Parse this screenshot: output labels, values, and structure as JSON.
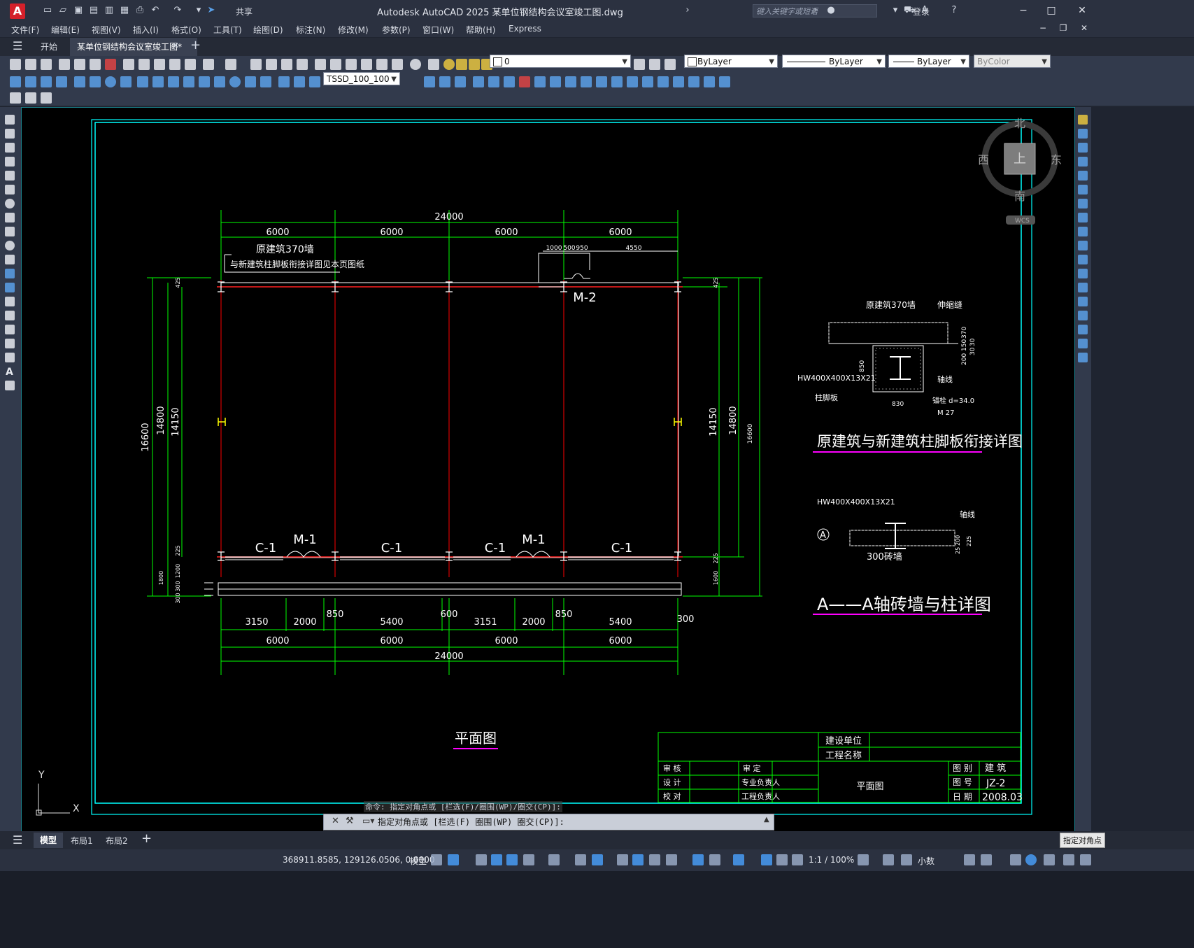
{
  "window": {
    "app_logo": "A",
    "title": "Autodesk AutoCAD 2025    某单位钢结构会议室竣工图.dwg",
    "share_label": "共享",
    "search_placeholder": "键入关键字或短语",
    "login_label": "登录"
  },
  "menu": [
    "文件(F)",
    "编辑(E)",
    "视图(V)",
    "插入(I)",
    "格式(O)",
    "工具(T)",
    "绘图(D)",
    "标注(N)",
    "修改(M)",
    "参数(P)",
    "窗口(W)",
    "帮助(H)",
    "Express"
  ],
  "tabs": {
    "start": "开始",
    "document": "某单位钢结构会议室竣工图*"
  },
  "toolbar": {
    "layer_value": "0",
    "color_value": "ByLayer",
    "linetype_value": "ByLayer",
    "lineweight_value": "ByLayer",
    "plotstyle_value": "ByColor",
    "dimstyle_value": "TSSD_100_100"
  },
  "viewcube": {
    "north": "北",
    "south": "南",
    "west": "西",
    "east": "东",
    "top": "上",
    "wcs": "WCS"
  },
  "drawing": {
    "plan_title": "平面图",
    "top_dims": [
      "24000",
      "6000",
      "6000",
      "6000",
      "6000"
    ],
    "top_detail_dims": [
      "1000",
      "500",
      "950",
      "4550"
    ],
    "note_line1": "原建筑370墙",
    "note_line2": "与新建筑柱脚板衔接详图见本页图纸",
    "door_top": "M-2",
    "openings": [
      "C-1",
      "M-1",
      "C-1",
      "C-1",
      "M-1",
      "C-1"
    ],
    "bottom_dims_row1": [
      "3150",
      "2000",
      "850",
      "5400",
      "600",
      "3151",
      "2000",
      "850",
      "5400",
      "300"
    ],
    "bottom_dims_row2": [
      "6000",
      "6000",
      "6000",
      "6000"
    ],
    "bottom_total": "24000",
    "left_dims": [
      "16600",
      "14800",
      "14150"
    ],
    "right_dims": [
      "14150",
      "14800",
      "16600"
    ],
    "small_dims_left": [
      "425",
      "225",
      "1800",
      "1200",
      "300",
      "300"
    ],
    "small_dims_right": [
      "425",
      "225",
      "1600"
    ],
    "detail1": {
      "title": "原建筑与新建筑柱脚板衔接详图",
      "labels": [
        "原建筑370墙",
        "伸缩缝",
        "HW400X400X13X21",
        "柱脚板",
        "轴线",
        "850",
        "830",
        "370",
        "200",
        "150",
        "30",
        "30",
        "锚栓 d=34.0",
        "M 27"
      ]
    },
    "detail2": {
      "title": "A——A轴砖墙与柱详图",
      "labels": [
        "HW400X400X13X21",
        "轴线",
        "A",
        "300砖墙",
        "200",
        "225",
        "25"
      ]
    },
    "title_block": {
      "client_label": "建设单位",
      "project_label": "工程名称",
      "rows": [
        [
          "审 核",
          "审 定"
        ],
        [
          "设 计",
          "专业负责人"
        ],
        [
          "校 对",
          "工程负责人"
        ]
      ],
      "drawing_name": "平面图",
      "category_label": "图 别",
      "category_value": "建 筑",
      "number_label": "图 号",
      "number_value": "JZ-2",
      "date_label": "日 期",
      "date_value": "2008.03"
    },
    "ucs_y": "Y",
    "ucs_x": "X"
  },
  "command": {
    "history": "命令: 指定对角点或 [栏选(F)/圈围(WP)/圈交(CP)]:",
    "prompt": "指定对角点或 [栏选(F) 圈围(WP) 圈交(CP)]:"
  },
  "layout_tabs": [
    "模型",
    "布局1",
    "布局2"
  ],
  "status": {
    "coords": "368911.8585, 129126.0506, 0.0000",
    "model_label": "模型",
    "scale": "1:1 / 100%",
    "units": "小数",
    "tooltip": "指定对角点"
  },
  "colors": {
    "accent_cyan": "#00ffff",
    "dimension_green": "#00ff00",
    "column_red": "#ff0000",
    "text_white": "#ffffff",
    "underline_magenta": "#ff00ff",
    "marker_yellow": "#ffff00"
  }
}
